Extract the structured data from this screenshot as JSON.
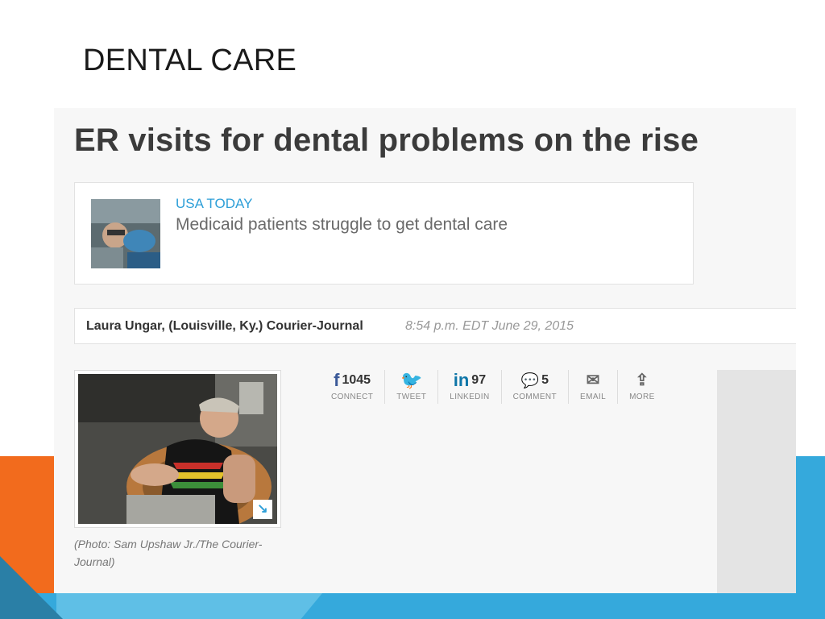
{
  "slide": {
    "title": "DENTAL CARE"
  },
  "article": {
    "headline": "ER visits for dental problems on the rise",
    "related": {
      "source": "USA TODAY",
      "title": "Medicaid patients struggle to get dental care"
    },
    "byline": {
      "author": "Laura Ungar, (Louisville, Ky.) Courier-Journal",
      "timestamp": "8:54 p.m. EDT June 29, 2015"
    },
    "photo": {
      "caption": "(Photo: Sam Upshaw Jr./The Courier-Journal)",
      "expand_icon": "↘"
    },
    "share": [
      {
        "icon": "f",
        "icon_name": "facebook-icon",
        "count": "1045",
        "label": "CONNECT",
        "color": "#3b5998"
      },
      {
        "icon": "🐦",
        "icon_name": "twitter-icon",
        "count": "",
        "label": "TWEET",
        "color": "#2e9fd8"
      },
      {
        "icon": "in",
        "icon_name": "linkedin-icon",
        "count": "97",
        "label": "LINKEDIN",
        "color": "#0e76a8"
      },
      {
        "icon": "💬",
        "icon_name": "comment-icon",
        "count": "5",
        "label": "COMMENT",
        "color": "#666666"
      },
      {
        "icon": "✉",
        "icon_name": "email-icon",
        "count": "",
        "label": "EMAIL",
        "color": "#666666"
      },
      {
        "icon": "⇪",
        "icon_name": "share-more-icon",
        "count": "",
        "label": "MORE",
        "color": "#666666"
      }
    ]
  }
}
